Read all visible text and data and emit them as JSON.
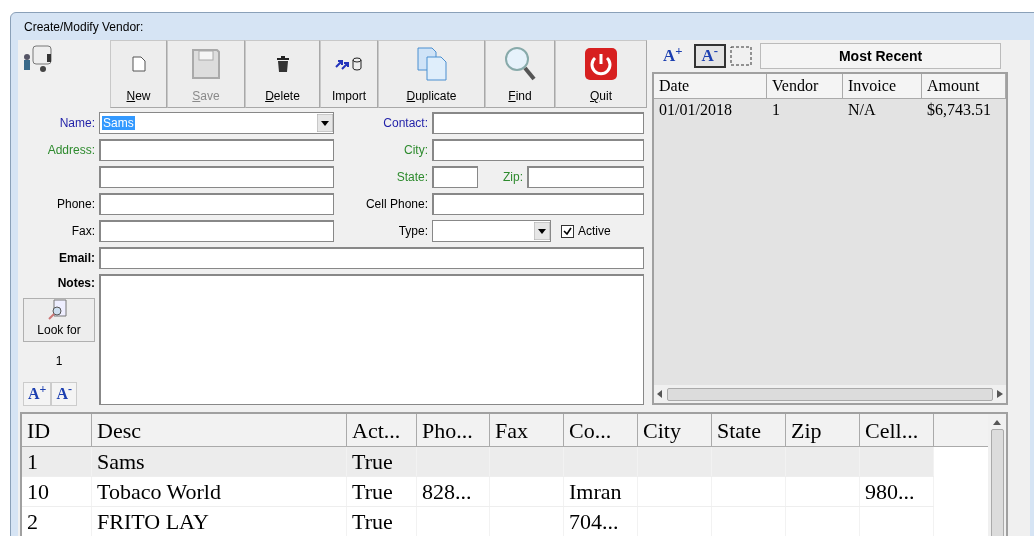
{
  "window": {
    "title": "Create/Modify Vendor:"
  },
  "toolbar": [
    {
      "label": "New",
      "kind": "new",
      "underlined": true,
      "disabled": false
    },
    {
      "label": "Save",
      "kind": "save",
      "underlined": true,
      "disabled": true
    },
    {
      "label": "Delete",
      "kind": "delete",
      "underlined": true,
      "disabled": false
    },
    {
      "label": "Import",
      "kind": "import",
      "underlined": false,
      "disabled": false
    },
    {
      "label": "Duplicate",
      "kind": "duplicate",
      "underlined": true,
      "disabled": false
    },
    {
      "label": "Find",
      "kind": "find",
      "underlined": true,
      "disabled": false
    },
    {
      "label": "Quit",
      "kind": "quit",
      "underlined": true,
      "disabled": false
    }
  ],
  "form": {
    "rows": [
      {
        "left": {
          "label": "Name:",
          "color": "#1f1fa8",
          "kind": "combo",
          "value": "Sams",
          "selected": true
        },
        "right": [
          {
            "label": "Contact:",
            "color": "#1f1fa8",
            "kind": "text"
          }
        ]
      },
      {
        "left": {
          "label": "Address:",
          "color": "#2d8a2d",
          "kind": "text"
        },
        "right": [
          {
            "label": "City:",
            "color": "#2d8a2d",
            "kind": "text"
          }
        ]
      },
      {
        "left": {
          "kind": "text"
        },
        "right": [
          {
            "label": "State:",
            "color": "#2d8a2d",
            "kind": "short"
          },
          {
            "label": "Zip:",
            "color": "#2d8a2d",
            "kind": "text"
          }
        ]
      },
      {
        "left": {
          "label": "Phone:",
          "color": "#000000",
          "kind": "text"
        },
        "right": [
          {
            "label": "Cell Phone:",
            "color": "#000000",
            "kind": "text"
          }
        ]
      },
      {
        "left": {
          "label": "Fax:",
          "color": "#000000",
          "kind": "text"
        },
        "right": [
          {
            "label": "Type:",
            "color": "#000000",
            "kind": "combo"
          },
          {
            "label": "Active",
            "kind": "checkbox",
            "checked": true
          }
        ]
      }
    ],
    "email": {
      "label": "Email:"
    },
    "notes": {
      "label": "Notes:"
    }
  },
  "look_for": {
    "label": "Look for",
    "count": "1"
  },
  "font_buttons": [
    {
      "label": "A$^{+}$"
    },
    {
      "label": "A$^{-}$"
    }
  ],
  "recent": {
    "font_buttons": [
      {
        "label": "A$^{+}$",
        "selected": false
      },
      {
        "label": "A$^{-}$",
        "selected": true
      }
    ],
    "title": "Most Recent",
    "columns": [
      "Date",
      "Vendor",
      "Invoice",
      "Amount"
    ],
    "rows": [
      [
        "01/01/2018",
        "1",
        "N/A",
        "$6,743.51"
      ]
    ]
  },
  "grid": {
    "columns": [
      "ID",
      "Desc",
      "Act...",
      "Pho...",
      "Fax",
      "Co...",
      "City",
      "State",
      "Zip",
      "Cell..."
    ],
    "rows": [
      {
        "cells": [
          "1",
          "Sams",
          "True",
          "",
          "",
          "",
          "",
          "",
          "",
          ""
        ],
        "selected": true
      },
      {
        "cells": [
          "10",
          "Tobaco World",
          "True",
          "828...",
          "",
          "Imran",
          "",
          "",
          "",
          "980..."
        ],
        "selected": false
      },
      {
        "cells": [
          "2",
          "FRITO LAY",
          "True",
          "",
          "",
          "704...",
          "",
          "",
          "",
          ""
        ],
        "selected": false
      }
    ]
  }
}
